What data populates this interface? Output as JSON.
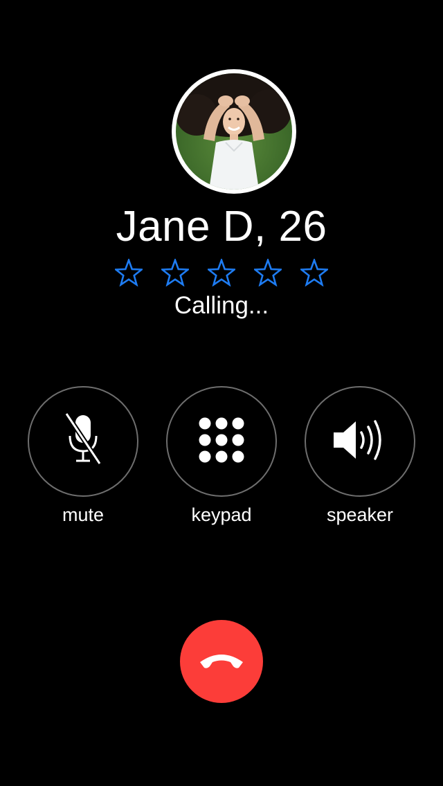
{
  "contact": {
    "name": "Jane D, 26",
    "status": "Calling...",
    "rating": {
      "max_stars": 5,
      "filled_stars": 0,
      "star_icon": "star-outline-icon",
      "star_color": "#1e7cf2"
    }
  },
  "controls": {
    "mute": {
      "label": "mute",
      "icon": "microphone-muted-icon"
    },
    "keypad": {
      "label": "keypad",
      "icon": "keypad-grid-icon"
    },
    "speaker": {
      "label": "speaker",
      "icon": "speaker-icon"
    }
  },
  "end_call": {
    "icon": "phone-hangup-icon",
    "color": "#fc3d39"
  },
  "colors": {
    "background": "#000000",
    "text": "#ffffff",
    "control_border": "#6e6e6e",
    "avatar_ring": "#ffffff"
  }
}
